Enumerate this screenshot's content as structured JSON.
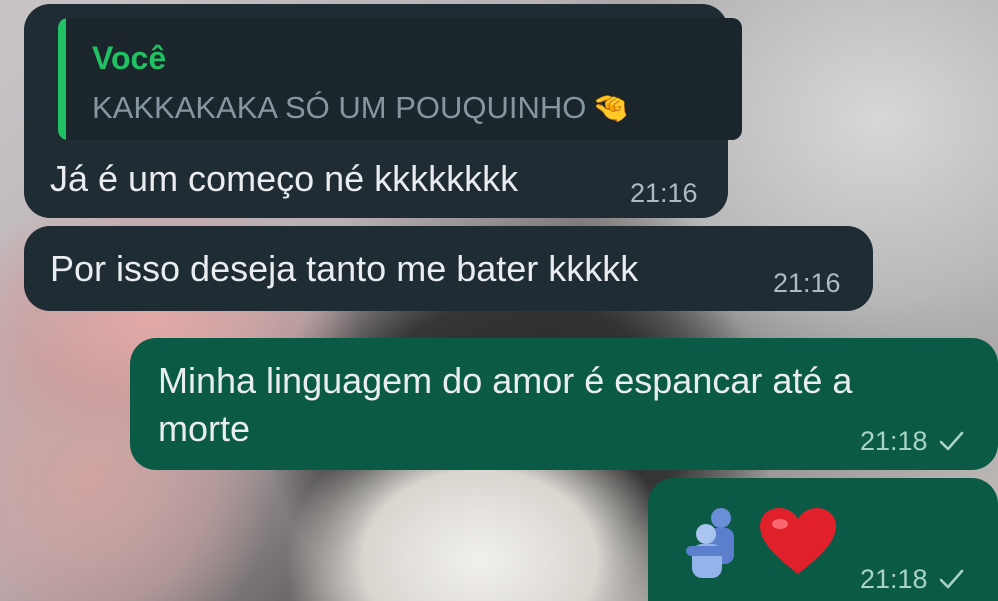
{
  "messages": [
    {
      "direction": "incoming",
      "quote": {
        "author": "Você",
        "text": "KAKKAKAKA SÓ UM POUQUINHO",
        "emoji": "🤏"
      },
      "text": "Já é um começo né kkkkkkkk",
      "time": "21:16"
    },
    {
      "direction": "incoming",
      "text": "Por isso deseja tanto me bater kkkkk",
      "time": "21:16"
    },
    {
      "direction": "outgoing",
      "text_line1": "Minha linguagem do amor é espancar até a",
      "text_line2": "morte",
      "time": "21:18",
      "status_icon": "single-check-icon"
    },
    {
      "direction": "outgoing",
      "emojis": [
        "hug-icon",
        "red-heart-icon"
      ],
      "time": "21:18",
      "status_icon": "single-check-icon"
    }
  ],
  "colors": {
    "incoming_bubble": "#1f2c34",
    "outgoing_bubble": "#0b5a45",
    "quote_accent": "#21c063",
    "timestamp": "#aebac1"
  }
}
